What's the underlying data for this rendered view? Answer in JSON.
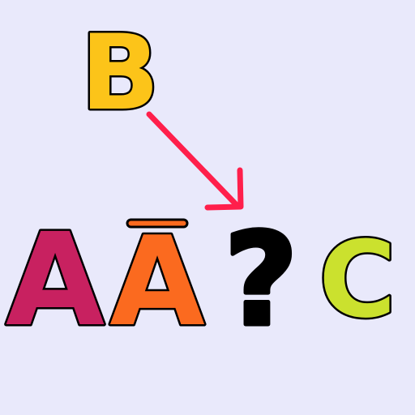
{
  "letters": {
    "top": {
      "text": "B",
      "color": "#fcc419"
    },
    "first": {
      "text": "A",
      "color": "#c82160"
    },
    "second": {
      "text": "A",
      "color": "#fb6a1f"
    },
    "unknown": {
      "text": "?",
      "color": "#000000"
    },
    "last": {
      "text": "C",
      "color": "#cbe12e"
    }
  },
  "macron": {
    "color": "#fb6a1f"
  },
  "arrow": {
    "color": "#ff1f4b"
  },
  "background": "#e9e9fb"
}
